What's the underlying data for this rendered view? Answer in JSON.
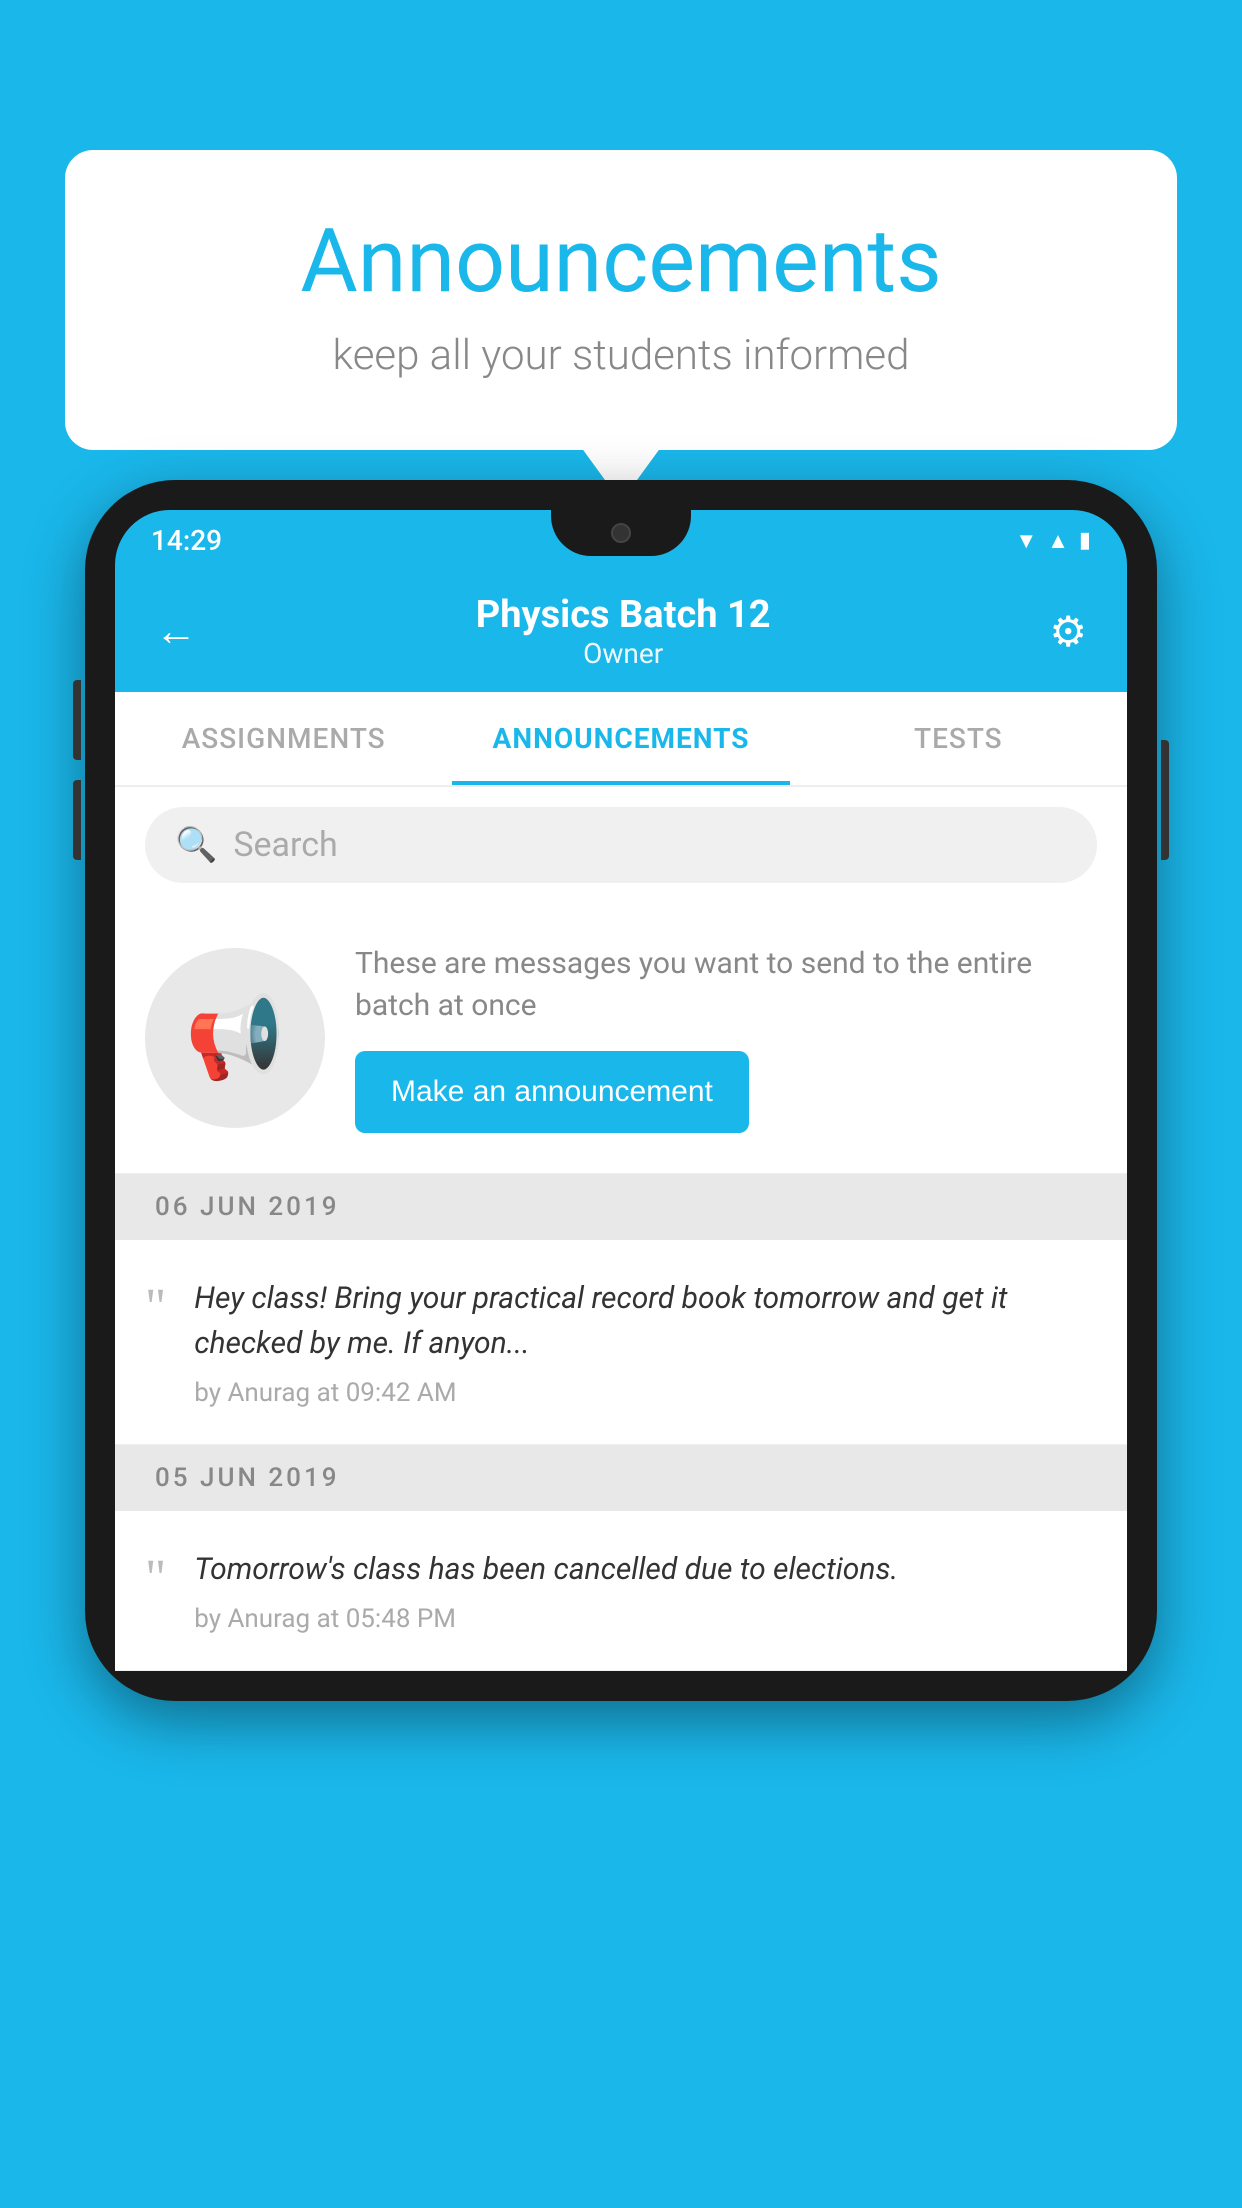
{
  "bubble": {
    "title": "Announcements",
    "subtitle": "keep all your students informed"
  },
  "phone": {
    "status_time": "14:29",
    "app_bar": {
      "title": "Physics Batch 12",
      "subtitle": "Owner",
      "back_label": "←",
      "gear_label": "⚙"
    },
    "tabs": [
      {
        "label": "ASSIGNMENTS",
        "active": false
      },
      {
        "label": "ANNOUNCEMENTS",
        "active": true
      },
      {
        "label": "TESTS",
        "active": false
      },
      {
        "label": "...",
        "active": false
      }
    ],
    "search": {
      "placeholder": "Search"
    },
    "cta": {
      "description": "These are messages you want to send to the entire batch at once",
      "button_label": "Make an announcement"
    },
    "announcements": [
      {
        "date": "06  JUN  2019",
        "text": "Hey class! Bring your practical record book tomorrow and get it checked by me. If anyon...",
        "meta": "by Anurag at 09:42 AM"
      },
      {
        "date": "05  JUN  2019",
        "text": "Tomorrow's class has been cancelled due to elections.",
        "meta": "by Anurag at 05:48 PM"
      }
    ]
  },
  "colors": {
    "primary": "#1ab7ea",
    "dark_bg": "#1a1a1a",
    "white": "#ffffff"
  }
}
